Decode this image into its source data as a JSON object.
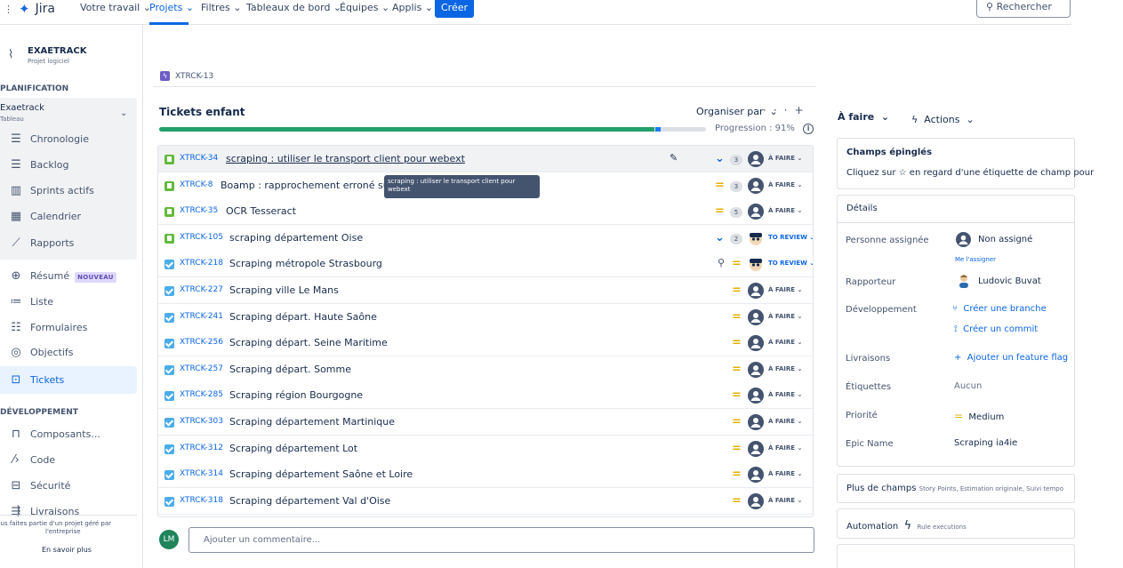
{
  "topnav": {
    "logo_text": "Jira",
    "items": [
      "Votre travail",
      "Projets",
      "Filtres",
      "Tableaux de bord",
      "Équipes",
      "Applis"
    ],
    "create_label": "Créer",
    "search_placeholder": "Rechercher"
  },
  "sidebar": {
    "project_name": "EXAETRACK",
    "project_type": "Projet logiciel",
    "section_planning": "PLANIFICATION",
    "board_name": "Exaetrack",
    "board_type": "Tableau",
    "planning_items": [
      "Chronologie",
      "Backlog",
      "Sprints actifs",
      "Calendrier",
      "Rapports"
    ],
    "other_items": [
      {
        "label": "Résumé",
        "badge": "NOUVEAU"
      },
      {
        "label": "Liste"
      },
      {
        "label": "Formulaires"
      },
      {
        "label": "Objectifs"
      },
      {
        "label": "Tickets"
      }
    ],
    "section_dev": "DÉVELOPPEMENT",
    "dev_items": [
      "Composants...",
      "Code",
      "Sécurité",
      "Livraisons"
    ],
    "footer_text_1": "Vous faites partie d'un projet géré par",
    "footer_text_2": "l'entreprise",
    "footer_link": "En savoir plus"
  },
  "issue": {
    "breadcrumb_key": "XTRCK-13",
    "child_title": "Tickets enfant",
    "organiser_label": "Organiser par",
    "progress_label": "Progression :",
    "progress_value": "91%",
    "progress_done_fraction": 0.91,
    "progress_inprogress_fraction": 0.01,
    "tooltip_text": "scraping : utiliser le transport client pour webext",
    "comment_avatar": "LM",
    "comment_placeholder": "Ajouter un commentaire..."
  },
  "children": [
    {
      "key": "XTRCK-34",
      "summary": "scraping : utiliser le transport client pour webext",
      "type": "story",
      "priority": "low",
      "points": "3",
      "assignee": "none",
      "status": "À FAIRE",
      "edit": true
    },
    {
      "key": "XTRCK-8",
      "summary": "Boamp : rapprochement erroné sur une p",
      "type": "story",
      "priority": "medium",
      "points": "3",
      "assignee": "none",
      "status": "À FAIRE"
    },
    {
      "key": "XTRCK-35",
      "summary": "OCR Tesseract",
      "type": "story",
      "priority": "medium",
      "points": "5",
      "assignee": "none",
      "status": "À FAIRE"
    },
    {
      "key": "XTRCK-105",
      "summary": "scraping département Oise",
      "type": "story",
      "priority": "low",
      "points": "2",
      "assignee": "user",
      "status": "TO REVIEW"
    },
    {
      "key": "XTRCK-218",
      "summary": "Scraping métropole Strasbourg",
      "type": "task",
      "priority": "medium",
      "points": "",
      "assignee": "user",
      "status": "TO REVIEW",
      "branch": true
    },
    {
      "key": "XTRCK-227",
      "summary": "Scraping ville Le Mans",
      "type": "task",
      "priority": "medium",
      "points": "",
      "assignee": "none",
      "status": "À FAIRE"
    },
    {
      "key": "XTRCK-241",
      "summary": "Scraping départ. Haute Saône",
      "type": "task",
      "priority": "medium",
      "points": "",
      "assignee": "none",
      "status": "À FAIRE"
    },
    {
      "key": "XTRCK-256",
      "summary": "Scraping départ. Seine Maritime",
      "type": "task",
      "priority": "medium",
      "points": "",
      "assignee": "none",
      "status": "À FAIRE"
    },
    {
      "key": "XTRCK-257",
      "summary": "Scraping départ. Somme",
      "type": "task",
      "priority": "medium",
      "points": "",
      "assignee": "none",
      "status": "À FAIRE"
    },
    {
      "key": "XTRCK-285",
      "summary": "Scraping région Bourgogne",
      "type": "task",
      "priority": "medium",
      "points": "",
      "assignee": "none",
      "status": "À FAIRE"
    },
    {
      "key": "XTRCK-303",
      "summary": "Scraping département Martinique",
      "type": "task",
      "priority": "medium",
      "points": "",
      "assignee": "none",
      "status": "À FAIRE"
    },
    {
      "key": "XTRCK-312",
      "summary": "Scraping département Lot",
      "type": "task",
      "priority": "medium",
      "points": "",
      "assignee": "none",
      "status": "À FAIRE"
    },
    {
      "key": "XTRCK-314",
      "summary": "Scraping département Saône et Loire",
      "type": "task",
      "priority": "medium",
      "points": "",
      "assignee": "none",
      "status": "À FAIRE"
    },
    {
      "key": "XTRCK-318",
      "summary": "Scraping département Val d'Oise",
      "type": "task",
      "priority": "medium",
      "points": "",
      "assignee": "none",
      "status": "À FAIRE"
    }
  ],
  "right_panel": {
    "status_label": "À faire",
    "actions_label": "Actions",
    "pinned_title": "Champs épinglés",
    "pinned_text": "Cliquez sur ☆ en regard d'une étiquette de champ pour",
    "details_title": "Détails",
    "fields": {
      "assignee_label": "Personne assignée",
      "assignee_value": "Non assigné",
      "assign_me": "Me l'assigner",
      "reporter_label": "Rapporteur",
      "reporter_value": "Ludovic Buvat",
      "dev_label": "Développement",
      "create_branch": "Créer une branche",
      "create_commit": "Créer un commit",
      "releases_label": "Livraisons",
      "feature_flag": "Ajouter un feature flag",
      "labels_label": "Étiquettes",
      "labels_value": "Aucun",
      "priority_label": "Priorité",
      "priority_value": "Medium",
      "epic_label": "Epic Name",
      "epic_value": "Scraping ia4ie"
    },
    "more_fields_title": "Plus de champs",
    "more_fields_sub": "Story Points, Estimation originale, Suivi tempo",
    "automation_title": "Automation",
    "automation_sub": "Rule executions"
  },
  "colors": {
    "accent": "#0c66e4",
    "done": "#22a06b",
    "medium_priority": "#e2b203"
  }
}
